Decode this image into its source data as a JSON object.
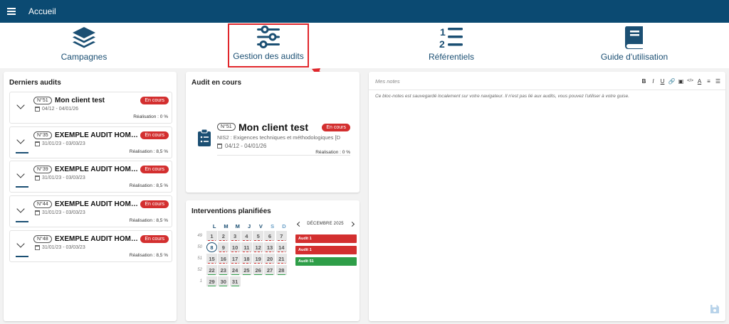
{
  "app": {
    "title": "Accueil"
  },
  "nav": [
    {
      "label": "Campagnes",
      "icon": "layers-icon"
    },
    {
      "label": "Gestion des audits",
      "icon": "sliders-icon"
    },
    {
      "label": "Référentiels",
      "icon": "ordered-list-icon"
    },
    {
      "label": "Guide d'utilisation",
      "icon": "book-icon"
    }
  ],
  "colors": {
    "topbar": "#0b4a72",
    "accent": "#1b4f73",
    "status_red": "#d32f2f",
    "highlight": "#e0262b",
    "event_green": "#2e9e48"
  },
  "recent_audits": {
    "title": "Derniers audits",
    "items": [
      {
        "num": "N°51",
        "name": "Mon client test",
        "dates": "04/12 - 04/01/26",
        "status": "En cours",
        "realisation": "Réalisation : 0 %"
      },
      {
        "num": "N°35",
        "name": "EXEMPLE AUDIT HOMOLOGATION",
        "dates": "31/01/23 - 03/03/23",
        "status": "En cours",
        "realisation": "Réalisation : 8,5 %"
      },
      {
        "num": "N°39",
        "name": "EXEMPLE AUDIT HOMOLOGATION",
        "dates": "31/01/23 - 03/03/23",
        "status": "En cours",
        "realisation": "Réalisation : 8,5 %"
      },
      {
        "num": "N°44",
        "name": "EXEMPLE AUDIT HOMOLOGATION",
        "dates": "31/01/23 - 03/03/23",
        "status": "En cours",
        "realisation": "Réalisation : 8,5 %"
      },
      {
        "num": "N°48",
        "name": "EXEMPLE AUDIT HOMOLOGATION",
        "dates": "31/01/23 - 03/03/23",
        "status": "En cours",
        "realisation": "Réalisation : 8,5 %"
      }
    ]
  },
  "current_audit": {
    "title": "Audit en cours",
    "num": "N°51",
    "name": "Mon client test",
    "status": "En cours",
    "referentiel": "NIS2 : Exigences techniques et méthodologiques [D",
    "dates": "04/12 - 04/01/26",
    "realisation": "Réalisation : 0 %"
  },
  "interventions": {
    "title": "Interventions planifiées",
    "month": "DÉCEMBRE 2025",
    "weekdays": [
      "L",
      "M",
      "M",
      "J",
      "V",
      "S",
      "D"
    ],
    "weeks": [
      {
        "week": "49",
        "days": [
          "1",
          "2",
          "3",
          "4",
          "5",
          "6",
          "7"
        ]
      },
      {
        "week": "50",
        "days": [
          "8",
          "9",
          "10",
          "11",
          "12",
          "13",
          "14"
        ]
      },
      {
        "week": "51",
        "days": [
          "15",
          "16",
          "17",
          "18",
          "19",
          "20",
          "21"
        ]
      },
      {
        "week": "52",
        "days": [
          "22",
          "23",
          "24",
          "25",
          "26",
          "27",
          "28"
        ]
      },
      {
        "week": "1",
        "days": [
          "29",
          "30",
          "31"
        ]
      }
    ],
    "events": [
      {
        "label": "Audit 1",
        "color": "#d32f2f"
      },
      {
        "label": "Audit 1",
        "color": "#d32f2f"
      },
      {
        "label": "Audit 51",
        "color": "#2e9e48"
      }
    ]
  },
  "notes": {
    "label": "Mes notes",
    "body": "Ce bloc-notes est sauvegardé localement sur votre navigateur. Il n'est pas lié aux audits, vous pouvez l'utiliser à votre guise.",
    "toolbar": [
      "B",
      "I",
      "U",
      "🔗",
      "▣",
      "</>",
      "A",
      "≡",
      "☰"
    ]
  }
}
